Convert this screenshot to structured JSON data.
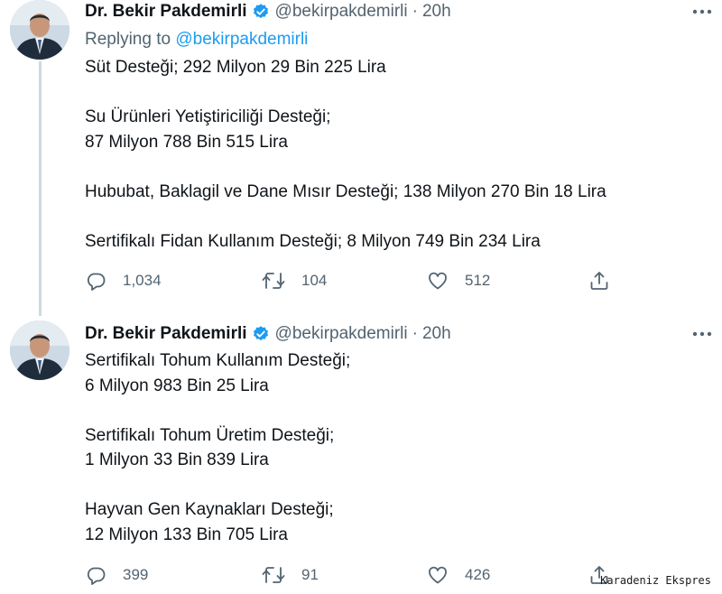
{
  "tweets": [
    {
      "author": {
        "name": "Dr. Bekir Pakdemirli",
        "handle": "@bekirpakdemirli",
        "time": "20h"
      },
      "replying_to_prefix": "Replying to ",
      "replying_to": "@bekirpakdemirli",
      "paragraphs": [
        [
          "Süt Desteği; 292 Milyon 29 Bin 225 Lira"
        ],
        [
          "Su Ürünleri Yetiştiriciliği Desteği;",
          "87 Milyon 788 Bin 515 Lira"
        ],
        [
          "Hububat, Baklagil ve Dane Mısır Desteği; 138 Milyon 270 Bin 18 Lira"
        ],
        [
          "Sertifikalı Fidan Kullanım Desteği; 8 Milyon 749 Bin 234 Lira"
        ]
      ],
      "stats": {
        "replies": "1,034",
        "retweets": "104",
        "likes": "512"
      }
    },
    {
      "author": {
        "name": "Dr. Bekir Pakdemirli",
        "handle": "@bekirpakdemirli",
        "time": "20h"
      },
      "paragraphs": [
        [
          "Sertifikalı Tohum Kullanım Desteği;",
          "6 Milyon 983 Bin 25 Lira"
        ],
        [
          "Sertifikalı Tohum Üretim Desteği;",
          "1 Milyon 33 Bin 839 Lira"
        ],
        [
          "Hayvan Gen Kaynakları Desteği;",
          "12 Milyon 133 Bin 705 Lira"
        ]
      ],
      "stats": {
        "replies": "399",
        "retweets": "91",
        "likes": "426"
      }
    }
  ],
  "separator": "·",
  "watermark": "Karadeniz Ekspres",
  "icons": {
    "verified": "verified-badge-icon",
    "more": "more-options-icon",
    "reply": "reply-icon",
    "retweet": "retweet-icon",
    "like": "heart-icon",
    "share": "share-icon"
  },
  "colors": {
    "accent": "#1d9bf0",
    "secondary_text": "#536471",
    "primary_text": "#0f1419",
    "thread_line": "#cfd9de"
  }
}
